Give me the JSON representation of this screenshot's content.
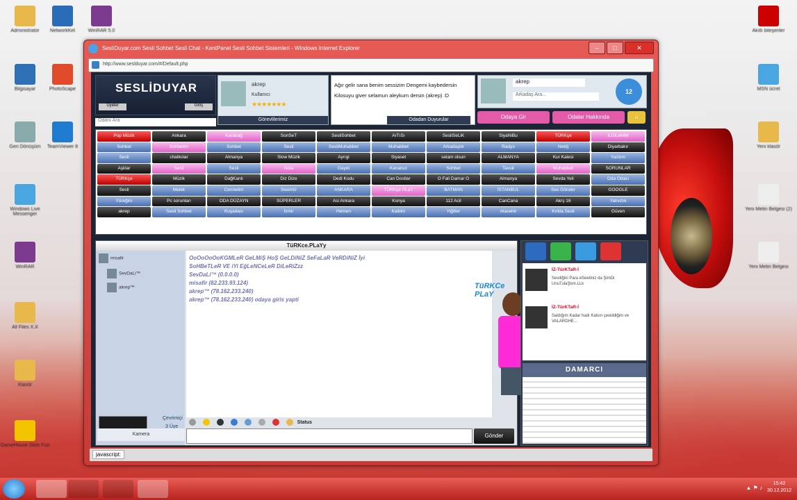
{
  "desktop": {
    "left_icons": [
      {
        "label": "Administrator",
        "color": "#e8b94a"
      },
      {
        "label": "NetworkKet",
        "color": "#2a6cb8"
      },
      {
        "label": "WinRAR 5.0",
        "color": "#7c3b8f"
      },
      {
        "label": "Bilgisayar",
        "color": "#2f6fb5"
      },
      {
        "label": "PhotoScape",
        "color": "#e04a2a"
      },
      {
        "label": "Geri Dönüşüm",
        "color": "#8aa"
      },
      {
        "label": "TeamViewer 8",
        "color": "#1f7bd0"
      },
      {
        "label": "Windows Live Messenger",
        "color": "#4aa6e0"
      },
      {
        "label": "WinRAR",
        "color": "#7c3b8f"
      },
      {
        "label": "All Files X.X",
        "color": "#e8b94a"
      },
      {
        "label": "Klasör",
        "color": "#e8b94a"
      },
      {
        "label": "GameHouse Slots Fun",
        "color": "#f4c400"
      }
    ],
    "right_icons": [
      {
        "label": "Akıllı bileşenler",
        "color": "#c00"
      },
      {
        "label": "MSN ücret",
        "color": "#4aa6e0"
      },
      {
        "label": "Yeni klasör",
        "color": "#e8b94a"
      },
      {
        "label": "Yeni Metin Belgesi (2)",
        "color": "#eee"
      },
      {
        "label": "Yeni Metin Belgesi",
        "color": "#eee"
      }
    ]
  },
  "window": {
    "title": "SesliDuyar.com Sesli Sohbet Sesli Chat - KentPanel Sesli Sohbet Sistemleri - Windows Internet Explorer",
    "address": "http://www.seslduyar.com/#/Default.php",
    "status": "javascript:",
    "min": "–",
    "max": "□",
    "close": "✕"
  },
  "site": {
    "logo": "SESLİDUYAR",
    "logo_left_btn": "Üyeler",
    "logo_right_btn": "Giriş",
    "room_search_placeholder": "Odanı Ara",
    "profile": {
      "name": "akrep",
      "subtitle": "Kullanıcı",
      "stars": "★★★★★★★",
      "button": "Görevlilerimiz"
    },
    "message": {
      "text": "Ağır gelir sana benim sessizim Dengemi kaybedersin Kilosuyu giver selamun aleykum dersin (akrep) :D",
      "button": "Odadan Duyurular"
    },
    "user_card": {
      "name": "akrep",
      "search_placeholder": "Arkadaş Ara...",
      "date": "12"
    },
    "buttons": [
      {
        "label": "Odaya Gir",
        "color": "#e35aa8"
      },
      {
        "label": "Odalar Hakkında",
        "color": "#e35aa8"
      }
    ]
  },
  "rooms": [
    {
      "label": "Pop Müzik",
      "style": "rd"
    },
    {
      "label": "Ankara",
      "style": ""
    },
    {
      "label": "Karabağ",
      "style": "pk"
    },
    {
      "label": "SonSeT",
      "style": ""
    },
    {
      "label": "SesliSohbet",
      "style": ""
    },
    {
      "label": "ArTıSı",
      "style": ""
    },
    {
      "label": "SesliSeLiK",
      "style": ""
    },
    {
      "label": "SiyaNiBu",
      "style": ""
    },
    {
      "label": "TÜRKçe",
      "style": "rd"
    },
    {
      "label": "iLGiLeNiM",
      "style": "pk"
    },
    {
      "label": "Sohbet",
      "style": "bl"
    },
    {
      "label": "Sohbetim",
      "style": "pk"
    },
    {
      "label": "Sohbet",
      "style": "bl"
    },
    {
      "label": "Sesli",
      "style": "bl"
    },
    {
      "label": "SesliMuhabbet",
      "style": "bl"
    },
    {
      "label": "Muhabbet",
      "style": "bl"
    },
    {
      "label": "Arkadaşlık",
      "style": "bl"
    },
    {
      "label": "Radyo",
      "style": "bl"
    },
    {
      "label": "Netdj",
      "style": "bl"
    },
    {
      "label": "Diyarbakır",
      "style": ""
    },
    {
      "label": "Sesli",
      "style": "bl"
    },
    {
      "label": "chatkolar",
      "style": ""
    },
    {
      "label": "Almanya",
      "style": ""
    },
    {
      "label": "Slow Müzik",
      "style": ""
    },
    {
      "label": "Ayrıgi",
      "style": ""
    },
    {
      "label": "Siyaset",
      "style": ""
    },
    {
      "label": "selam olsun",
      "style": ""
    },
    {
      "label": "ALMANYA",
      "style": ""
    },
    {
      "label": "Kur Kalesi",
      "style": ""
    },
    {
      "label": "Yazılım",
      "style": "bl"
    },
    {
      "label": "Aşklar",
      "style": ""
    },
    {
      "label": "Sesli",
      "style": "pk"
    },
    {
      "label": "Sesli",
      "style": "bl"
    },
    {
      "label": "Nota",
      "style": "pk"
    },
    {
      "label": "Gayet",
      "style": "bl"
    },
    {
      "label": "Kanatsız",
      "style": "bl"
    },
    {
      "label": "Sohbet",
      "style": "bl"
    },
    {
      "label": "Tavuk",
      "style": "bl"
    },
    {
      "label": "Muhabbet",
      "style": "pk"
    },
    {
      "label": "SORUNLAR",
      "style": ""
    },
    {
      "label": "TÜRKçe",
      "style": "rd"
    },
    {
      "label": "Müzik",
      "style": ""
    },
    {
      "label": "DağKanlı",
      "style": ""
    },
    {
      "label": "Diz Dize",
      "style": ""
    },
    {
      "label": "Dedi Kodu",
      "style": ""
    },
    {
      "label": "Can Dostlar",
      "style": ""
    },
    {
      "label": "O Fali Damar O",
      "style": ""
    },
    {
      "label": "Almanya",
      "style": ""
    },
    {
      "label": "Sevda Yeli",
      "style": ""
    },
    {
      "label": "Oda Odası",
      "style": "bl"
    },
    {
      "label": "Sesli",
      "style": ""
    },
    {
      "label": "Melek",
      "style": "bl"
    },
    {
      "label": "Cennetim",
      "style": "bl"
    },
    {
      "label": "Sesimiz",
      "style": "bl"
    },
    {
      "label": "ANKARA",
      "style": "bl"
    },
    {
      "label": "TÜRKçe PLaY",
      "style": "pk"
    },
    {
      "label": "BATMAN",
      "style": "bl"
    },
    {
      "label": "İSTANBUL",
      "style": "bl"
    },
    {
      "label": "Ses Gönder",
      "style": "bl"
    },
    {
      "label": "GOOGLE",
      "style": ""
    },
    {
      "label": "Yüreğim",
      "style": "bl"
    },
    {
      "label": "Pc sorunları",
      "style": ""
    },
    {
      "label": "ODA DÜZAYN",
      "style": ""
    },
    {
      "label": "SÜPERLER",
      "style": ""
    },
    {
      "label": "Asi Ankara",
      "style": ""
    },
    {
      "label": "Konya",
      "style": ""
    },
    {
      "label": "112 Acil",
      "style": ""
    },
    {
      "label": "CanCana",
      "style": ""
    },
    {
      "label": "Akrş 16",
      "style": ""
    },
    {
      "label": "Yalnızlık",
      "style": "bl"
    },
    {
      "label": "akrep",
      "style": ""
    },
    {
      "label": "Sesli Sohbet",
      "style": "bl"
    },
    {
      "label": "Kuşadası",
      "style": "bl"
    },
    {
      "label": "İzmir",
      "style": "bl"
    },
    {
      "label": "Hemen",
      "style": "bl"
    },
    {
      "label": "Kalbim",
      "style": "bl"
    },
    {
      "label": "Yiğitler",
      "style": "bl"
    },
    {
      "label": "Atasehir",
      "style": "bl"
    },
    {
      "label": "Kırkla Sesli",
      "style": "bl"
    },
    {
      "label": "Güven",
      "style": ""
    }
  ],
  "chat": {
    "room_title": "TüRKce.PLaYy",
    "users": [
      {
        "name": "misafir"
      },
      {
        "name": "SevDaLi™"
      },
      {
        "name": "akrep™"
      }
    ],
    "messages": [
      "OoOoOoOoKGMLeR GeLMiŞ HoŞ GeLDiNiZ SeFaLaR VeRDiNiZ İyi",
      "SoHBeTLeR VE iYi EğLeNCeLeR DiLeRiZzz",
      "SevDaLi™ (0.0.0.0)",
      "misafir (82.233.93.124)",
      "akrep™ (78.162.233.240)",
      "akrep™ (78.162.233.240) odaya giris yapti"
    ],
    "logo_text": "TüRKCe PLaY",
    "toolbar_status": "Status",
    "send": "Gönder",
    "side_link": "Çevrimiçi",
    "side_count": "3 Üye",
    "side_button": "Kamera"
  },
  "right_panel": {
    "feed": [
      {
        "name": "İZ-TürKTaR-İ",
        "text": "Seviliğini Para eSeetiniz da ŞimDi UnuTulaŞtım.LLk"
      },
      {
        "name": "İZ-TürKTaR-İ",
        "text": "Saldığım Kadar hadı Kalsın çeviddiğim ve VALARDHE..."
      }
    ],
    "dama_title": "DAMARCI"
  },
  "taskbar": {
    "time": "15:42",
    "date": "30.12.2012"
  }
}
